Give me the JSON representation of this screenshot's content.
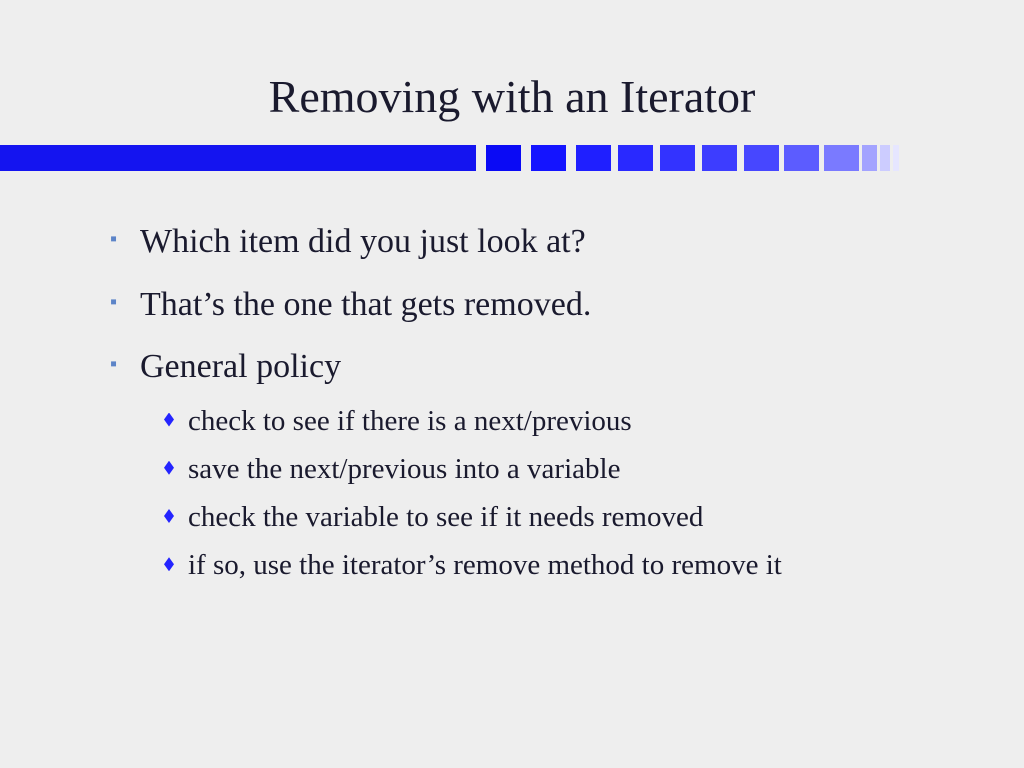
{
  "title": "Removing with an Iterator",
  "bullets": [
    {
      "text": "Which item did you just look at?"
    },
    {
      "text": "That’s the one that gets removed."
    },
    {
      "text": "General policy",
      "sub": [
        "check to see if there is a next/previous",
        "save the next/previous into a variable",
        "check the variable to see if it needs removed",
        "if so, use the iterator’s remove method to remove it"
      ]
    }
  ]
}
